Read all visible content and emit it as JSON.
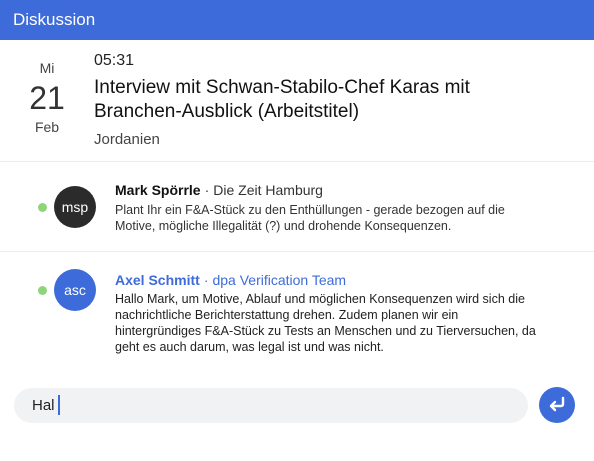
{
  "window": {
    "title": "Diskussion"
  },
  "event": {
    "weekday": "Mi",
    "day": "21",
    "month": "Feb",
    "time": "05:31",
    "title": "Interview mit Schwan-Stabilo-Chef Karas mit Branchen-Ausblick (Arbeitstitel)",
    "location": "Jordanien"
  },
  "messages": [
    {
      "initials": "msp",
      "name": "Mark Spörrle",
      "separator": "·",
      "org": "Die Zeit Hamburg",
      "text": "Plant Ihr ein F&A-Stück zu den Enthüllungen - gerade bezogen auf die Motive, mögliche Illegalität (?) und drohende Konsequenzen.",
      "online": true
    },
    {
      "initials": "asc",
      "name": "Axel Schmitt",
      "separator": "·",
      "org": "dpa Verification Team",
      "text": "Hallo Mark, um Motive, Ablauf und möglichen Konsequenzen wird sich die nachrichtliche Berichterstattung drehen. Zudem planen wir ein hintergründiges F&A-Stück zu Tests an Menschen und zu Tierversuchen, da geht es auch darum, was legal ist und was nicht.",
      "online": true
    }
  ],
  "composer": {
    "value": "Hal",
    "send_icon": "enter-return-icon"
  },
  "colors": {
    "accent": "#3d6bd9",
    "online": "#8ed57a",
    "avatar_dark": "#2b2b2b",
    "composer_bg": "#f1f2f4"
  }
}
